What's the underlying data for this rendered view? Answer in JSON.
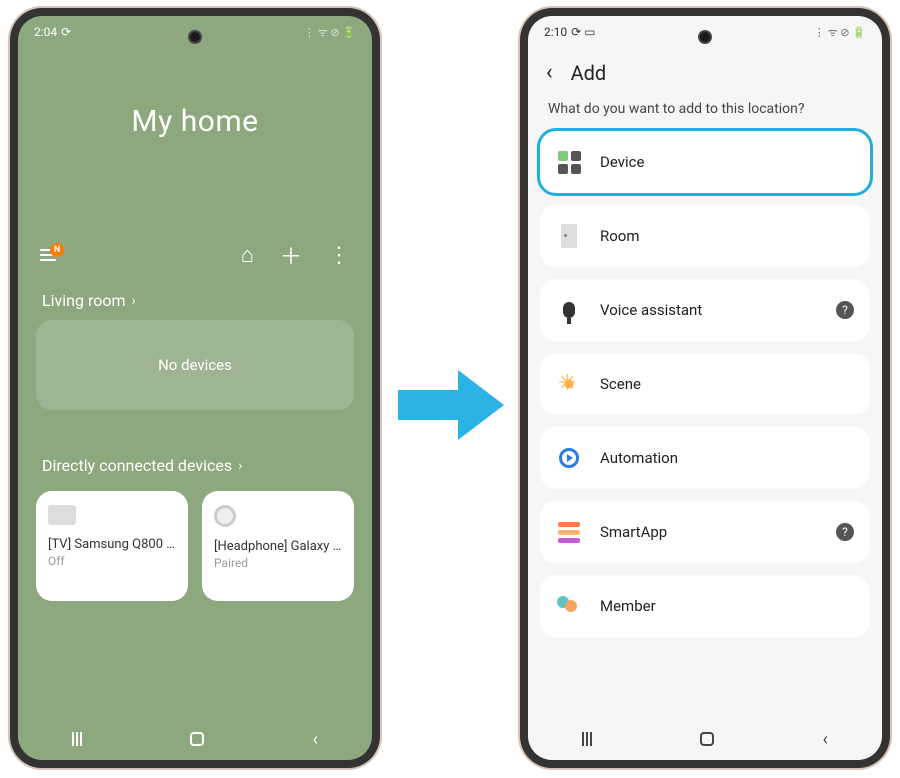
{
  "left": {
    "status_time": "2:04",
    "status_icons": "⟳",
    "status_right": "⋮ ᯤ ⊘ 🔋",
    "home_title": "My home",
    "menu_badge": "N",
    "section_room": "Living room",
    "empty_text": "No devices",
    "section_direct": "Directly connected devices",
    "devices": [
      {
        "name": "[TV] Samsung Q800 …",
        "status": "Off"
      },
      {
        "name": "[Headphone] Galaxy …",
        "status": "Paired"
      }
    ]
  },
  "right": {
    "status_time": "2:10",
    "status_icons": "⟳ ▭",
    "status_right": "⋮ ᯤ ⊘ 🔋",
    "title": "Add",
    "prompt": "What do you want to add to this location?",
    "options": {
      "device": "Device",
      "room": "Room",
      "voice": "Voice assistant",
      "scene": "Scene",
      "automation": "Automation",
      "smartapp": "SmartApp",
      "member": "Member"
    }
  }
}
